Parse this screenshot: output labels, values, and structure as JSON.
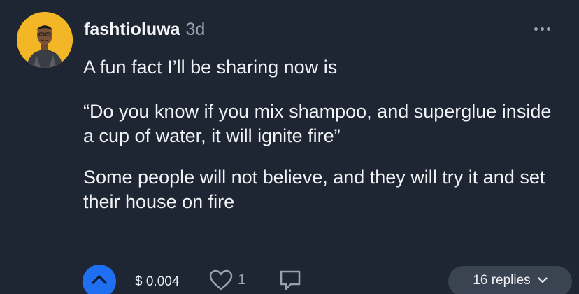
{
  "post": {
    "username": "fashtioluwa",
    "time": "3d",
    "paragraphs": [
      "A fun fact I’ll be sharing now is",
      "“Do you know if you mix shampoo, and superglue inside a cup of water, it will ignite fire”",
      "Some people will not believe, and they will try it and set their house on fire"
    ]
  },
  "actions": {
    "tip": "$ 0.004",
    "likes": "1",
    "replies": "16 replies"
  },
  "icons": {
    "avatar": "profile-photo",
    "more": "more-horizontal-icon",
    "upvote": "chevron-up-icon",
    "like": "heart-icon",
    "comment": "comment-bubble-icon",
    "replies_toggle": "chevron-down-icon"
  },
  "colors": {
    "background": "#1e2533",
    "upvote": "#1f6ff2",
    "avatar_bg": "#f2b626",
    "replies_pill": "#3a4351",
    "muted": "#9aa1ad"
  }
}
